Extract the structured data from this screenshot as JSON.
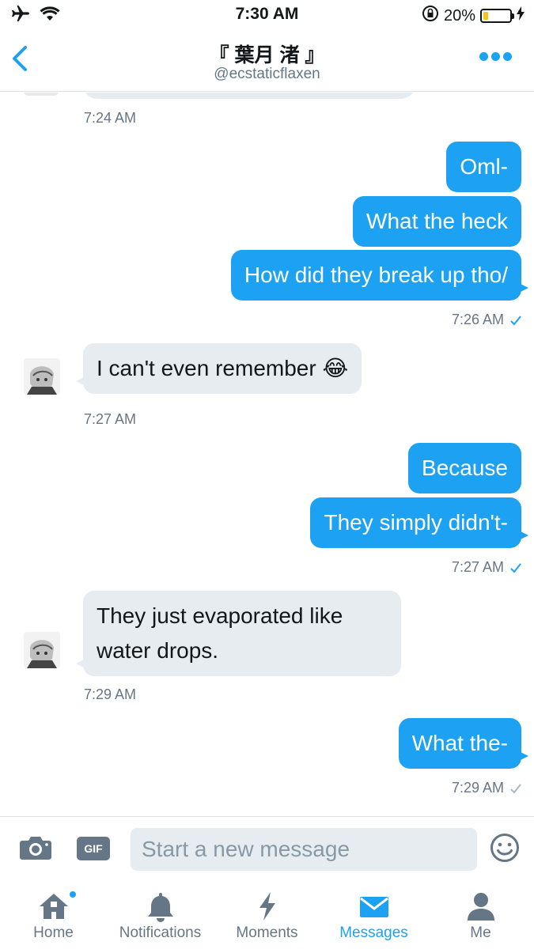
{
  "status_bar": {
    "time": "7:30 AM",
    "battery_percent": "20%",
    "battery_level": 0.2
  },
  "header": {
    "title": "『 葉月 渚 』",
    "handle": "@ecstaticflaxen",
    "accent_color": "#1da1f2"
  },
  "conversation": {
    "messages": [
      {
        "timestamp": "7:24 AM"
      },
      {
        "bubbles": [
          "Oml-",
          "What the heck",
          "How did they break up tho/"
        ],
        "timestamp": "7:26 AM",
        "status": "read"
      },
      {
        "text": "I can't even remember 😂",
        "timestamp": "7:27 AM"
      },
      {
        "bubbles": [
          "Because",
          "They simply didn't-"
        ],
        "timestamp": "7:27 AM",
        "status": "read"
      },
      {
        "text": "They just evaporated like water drops.",
        "timestamp": "7:29 AM"
      },
      {
        "bubbles": [
          "What the-"
        ],
        "timestamp": "7:29 AM",
        "status": "sent"
      }
    ]
  },
  "composer": {
    "placeholder": "Start a new message",
    "gif_label": "GIF"
  },
  "tabbar": {
    "tabs": [
      {
        "label": "Home",
        "icon": "home-icon"
      },
      {
        "label": "Notifications",
        "icon": "bell-icon"
      },
      {
        "label": "Moments",
        "icon": "lightning-icon"
      },
      {
        "label": "Messages",
        "icon": "envelope-icon",
        "active": true
      },
      {
        "label": "Me",
        "icon": "person-icon"
      }
    ]
  }
}
